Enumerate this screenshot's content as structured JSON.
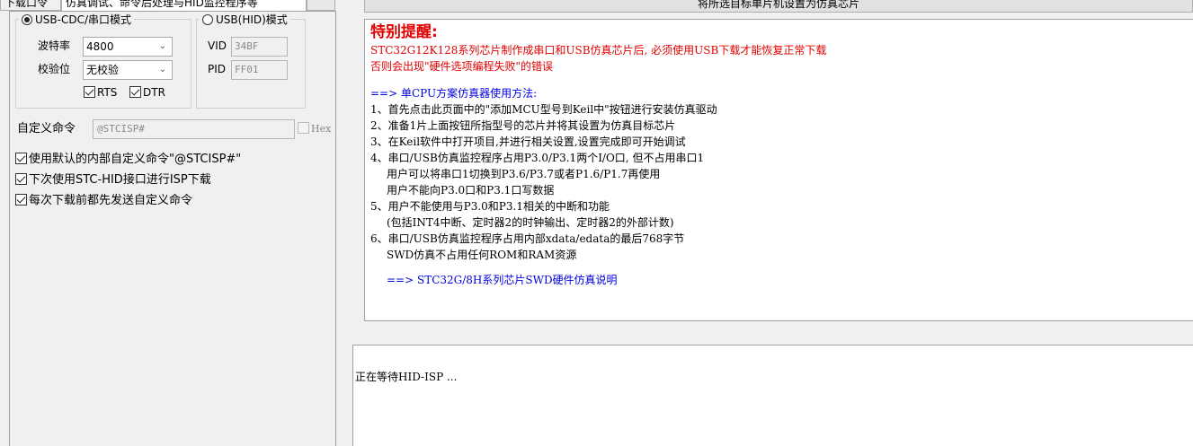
{
  "tabs": [
    {
      "label": "下载口令",
      "active": false
    },
    {
      "label": "仿真调试、命令后处理与HID监控程序等",
      "active": true
    }
  ],
  "banner_button": "将所选目标单片机设置为仿真芯片",
  "comm": {
    "usb_cdc_label": "USB-CDC/串口模式",
    "usb_cdc_selected": true,
    "baud_label": "波特率",
    "baud_value": "4800",
    "parity_label": "校验位",
    "parity_value": "无校验",
    "rts_label": "RTS",
    "rts_checked": true,
    "dtr_label": "DTR",
    "dtr_checked": true,
    "usb_hid_label": "USB(HID)模式",
    "usb_hid_selected": false,
    "vid_label": "VID",
    "vid_value": "34BF",
    "pid_label": "PID",
    "pid_value": "FF01"
  },
  "custom_cmd": {
    "label": "自定义命令",
    "value": "@STCISP#",
    "hex_label": "Hex",
    "hex_checked": false
  },
  "options": [
    {
      "label": "使用默认的内部自定义命令\"@STCISP#\"",
      "checked": true
    },
    {
      "label": "下次使用STC-HID接口进行ISP下载",
      "checked": true
    },
    {
      "label": "每次下载前都先发送自定义命令",
      "checked": true
    }
  ],
  "info": {
    "title": "特别提醒:",
    "warn_1": "STC32G12K128系列芯片制作成串口和USB仿真芯片后, 必须使用USB下载才能恢复正常下载",
    "warn_2": "否则会出现\"硬件选项编程失败\"的错误",
    "section_heading": "==> 单CPU方案仿真器使用方法:",
    "lines": [
      {
        "text": "1、首先点击此页面中的\"添加MCU型号到Keil中\"按钮进行安装仿真驱动",
        "indent": false
      },
      {
        "text": "2、准备1片上面按钮所指型号的芯片并将其设置为仿真目标芯片",
        "indent": false
      },
      {
        "text": "3、在Keil软件中打开项目,并进行相关设置,设置完成即可开始调试",
        "indent": false
      },
      {
        "text": "4、串口/USB仿真监控程序占用P3.0/P3.1两个I/O口, 但不占用串口1",
        "indent": false
      },
      {
        "text": "用户可以将串口1切换到P3.6/P3.7或者P1.6/P1.7再使用",
        "indent": true
      },
      {
        "text": "用户不能向P3.0口和P3.1口写数据",
        "indent": true
      },
      {
        "text": "5、用户不能使用与P3.0和P3.1相关的中断和功能",
        "indent": false
      },
      {
        "text": "(包括INT4中断、定时器2的时钟输出、定时器2的外部计数)",
        "indent": true
      },
      {
        "text": "6、串口/USB仿真监控程序占用内部xdata/edata的最后768字节",
        "indent": false
      },
      {
        "text": "SWD仿真不占用任何ROM和RAM资源",
        "indent": true
      }
    ],
    "cut_line": "==> STC32G/8H系列芯片SWD硬件仿真说明"
  },
  "log": {
    "lines": [
      "正在等待HID-ISP ..."
    ]
  }
}
